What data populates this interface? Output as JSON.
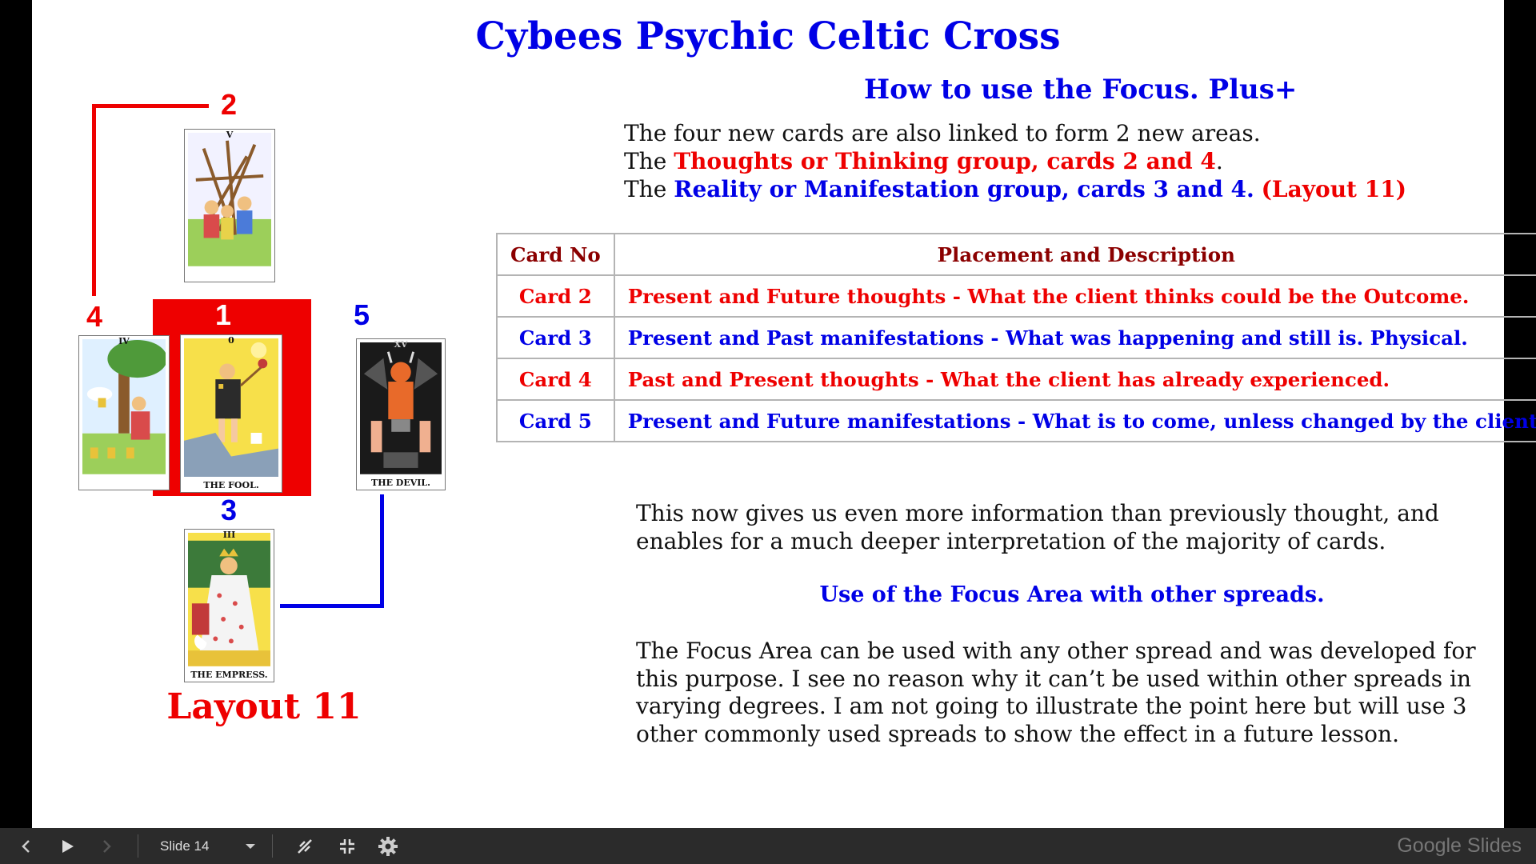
{
  "slide": {
    "title": "Cybees Psychic Celtic Cross",
    "subtitle": "How to use the Focus. Plus+",
    "intro": {
      "line1": "The four new cards are also linked to form 2 new areas.",
      "line2_prefix": "The ",
      "line2_highlight": "Thoughts or Thinking group, cards 2 and 4",
      "line2_suffix": ".",
      "line3_prefix": "The ",
      "line3_highlight": "Reality or Manifestation group, cards 3 and 4.",
      "line3_layout": "(Layout 11)"
    },
    "table": {
      "headers": [
        "Card No",
        "Placement and Description"
      ],
      "rows": [
        {
          "card": "Card 2",
          "description": "Present and Future thoughts - What the client thinks could be the Outcome.",
          "color": "#ee0000"
        },
        {
          "card": "Card 3",
          "description": "Present and Past manifestations - What was happening and still is. Physical.",
          "color": "#0000e6"
        },
        {
          "card": "Card 4",
          "description": "Past and Present thoughts - What the client has already experienced.",
          "color": "#ee0000"
        },
        {
          "card": "Card 5",
          "description": "Present and Future manifestations - What is to come, unless changed by the client.",
          "color": "#0000e6"
        }
      ]
    },
    "paragraph1": "This now gives us even more information than previously thought, and enables for a much deeper interpretation of the majority of cards.",
    "focus_heading": "Use of the Focus Area with other spreads.",
    "paragraph2": "The Focus Area can be used with any other spread and was developed for this purpose. I see no reason why it can’t be used within other spreads in varying degrees. I am not going to illustrate the point here but will use 3 other commonly used spreads to show the effect in a future lesson.",
    "layout": {
      "label": "Layout 11",
      "numbers": {
        "n1": "1",
        "n2": "2",
        "n3": "3",
        "n4": "4",
        "n5": "5"
      },
      "cards": {
        "top_numeral": "V",
        "fool_numeral": "0",
        "fool": "THE FOOL.",
        "devil_numeral": "XV",
        "devil": "THE DEVIL.",
        "left_numeral": "IV",
        "empress_numeral": "III",
        "empress": "THE EMPRESS."
      },
      "colors": {
        "red": "#ee0000",
        "blue": "#0000e6"
      }
    }
  },
  "toolbar": {
    "slide_label": "Slide 14",
    "brand": "Google Slides",
    "icons": [
      "chevron-left-icon",
      "play-icon",
      "chevron-right-icon",
      "dropdown-arrow-icon",
      "laser-pointer-icon",
      "exit-fullscreen-icon",
      "gear-icon"
    ]
  }
}
